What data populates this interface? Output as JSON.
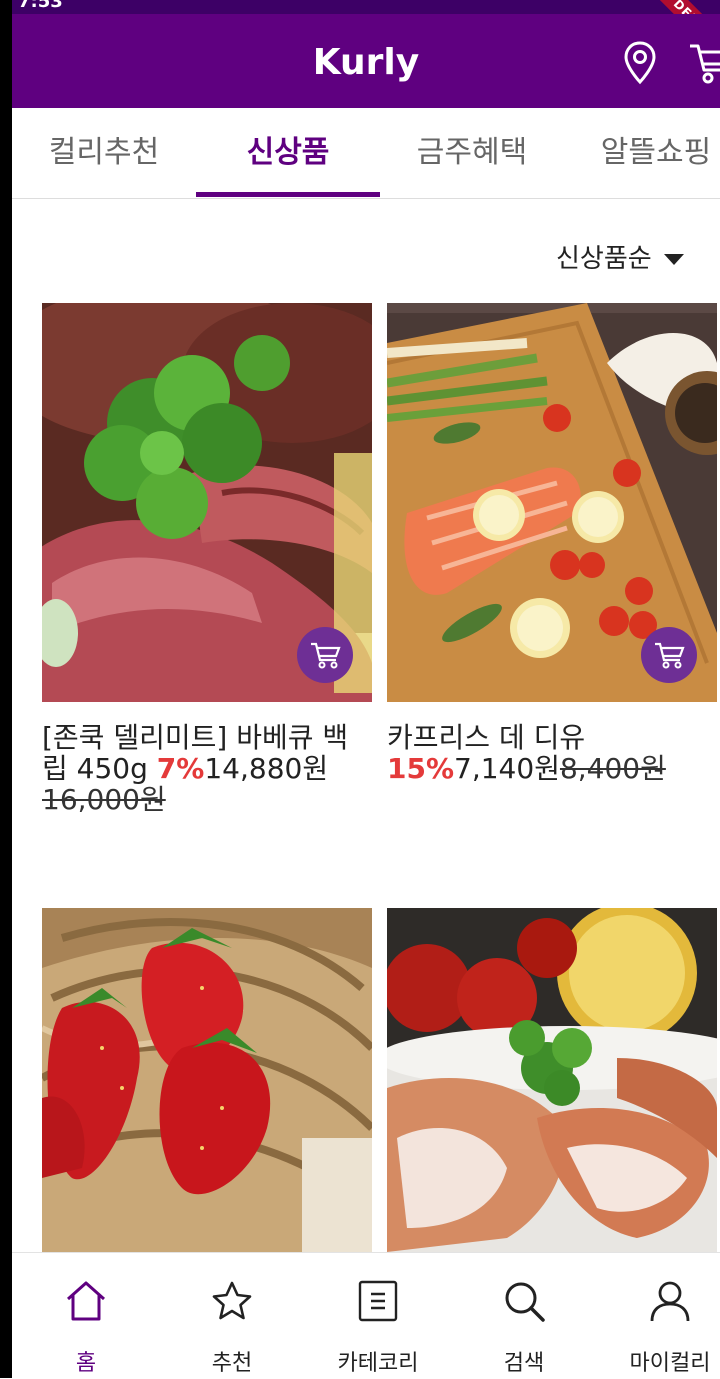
{
  "status": {
    "time": "7:53"
  },
  "debug_banner": "DEBUG",
  "app": {
    "title": "Kurly",
    "brand_color": "#5f0080",
    "discount_color": "#e43a3a"
  },
  "tabs": [
    {
      "label": "컬리추천",
      "active": false
    },
    {
      "label": "신상품",
      "active": true
    },
    {
      "label": "금주혜택",
      "active": false
    },
    {
      "label": "알뜰쇼핑",
      "active": false
    }
  ],
  "sort": {
    "label": "신상품순",
    "icon": "caret-down-icon"
  },
  "products": [
    {
      "image": "steak-image",
      "name": "[존쿡 델리미트] 바베큐 백립 450g",
      "name_line1": "[존쿡 델리미트] 바베큐 백",
      "name_line2": "립 450g",
      "discount": "7%",
      "price": "14,880원",
      "original_price": "16,000원"
    },
    {
      "image": "salmon-image",
      "name": "카프리스 데 디유",
      "discount": "15%",
      "price": "7,140원",
      "original_price": "8,400원"
    },
    {
      "image": "strawberry-image"
    },
    {
      "image": "shrimp-image"
    }
  ],
  "bottom_nav": [
    {
      "label": "홈",
      "icon": "home-icon",
      "active": true
    },
    {
      "label": "추천",
      "icon": "star-icon",
      "active": false
    },
    {
      "label": "카테코리",
      "icon": "category-icon",
      "active": false
    },
    {
      "label": "검색",
      "icon": "search-icon",
      "active": false
    },
    {
      "label": "마이컬리",
      "icon": "user-icon",
      "active": false
    }
  ]
}
